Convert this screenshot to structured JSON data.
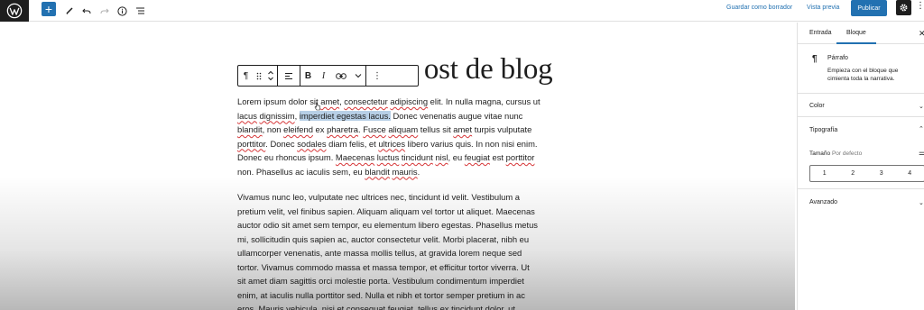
{
  "topbar": {
    "inserter_symbol": "+",
    "save_draft": "Guardar como borrador",
    "preview": "Vista previa",
    "publish": "Publicar",
    "icons": [
      "wordpress-logo",
      "plus-icon",
      "pen-icon",
      "undo-icon",
      "redo-icon",
      "info-icon",
      "list-view-icon",
      "gear-icon",
      "more-vertical-icon"
    ]
  },
  "editor": {
    "title_visible_end": "ost de blog",
    "toolbar": {
      "paragraph_symbol": "¶",
      "bold": "B",
      "italic": "I"
    },
    "paragraph1": {
      "lines": [
        [
          "Lorem ipsum dolor sit ",
          {
            "t": "amet",
            "sq": true
          },
          ", ",
          {
            "t": "consectetur",
            "sq": true
          },
          " ",
          {
            "t": "adipiscing",
            "sq": true
          },
          " elit. In nulla magna, cursus ut"
        ],
        [
          {
            "t": "lacus",
            "sq": true
          },
          " ",
          {
            "t": "dignissim",
            "sq": true
          },
          ", ",
          {
            "t": "imperdiet egestas lacus.",
            "hl": true
          },
          " Donec venenatis augue vitae nunc"
        ],
        [
          {
            "t": "blandit",
            "sq": true
          },
          ", non ",
          {
            "t": "eleifend",
            "sq": true
          },
          " ex ",
          {
            "t": "pharetra",
            "sq": true
          },
          ". ",
          {
            "t": "Fusce",
            "sq": true
          },
          " ",
          {
            "t": "aliquam",
            "sq": true
          },
          " tellus sit ",
          {
            "t": "amet",
            "sq": true
          },
          " turpis vulputate"
        ],
        [
          {
            "t": "porttitor",
            "sq": true
          },
          ". Donec ",
          {
            "t": "sodales",
            "sq": true
          },
          " diam felis, et ",
          {
            "t": "ultrices",
            "sq": true
          },
          " libero varius quis. In non nisi enim."
        ],
        [
          "Donec eu rhoncus ipsum. ",
          {
            "t": "Maecenas",
            "sq": true
          },
          " ",
          {
            "t": "luctus",
            "sq": true
          },
          " ",
          {
            "t": "tincidunt",
            "sq": true
          },
          " ",
          {
            "t": "nisl",
            "sq": true
          },
          ", eu ",
          {
            "t": "feugiat",
            "sq": true
          },
          " est ",
          {
            "t": "porttitor",
            "sq": true
          }
        ],
        [
          "non. Phasellus ac iaculis sem, eu ",
          {
            "t": "blandit",
            "sq": true
          },
          " ",
          {
            "t": "mauris",
            "sq": true
          },
          "."
        ]
      ]
    },
    "paragraph2": {
      "lines": [
        [
          "Vivamus nunc leo, vulputate nec ultrices nec, tincidunt id velit. Vestibulum a"
        ],
        [
          "pretium velit, vel finibus sapien. Aliquam aliquam vel tortor ut aliquet. Maecenas"
        ],
        [
          "auctor odio sit amet sem tempor, eu elementum libero egestas. Phasellus metus"
        ],
        [
          "mi, sollicitudin quis sapien ac, auctor consectetur velit. Morbi placerat, nibh eu"
        ],
        [
          "ullamcorper venenatis, ante massa mollis tellus, at gravida lorem neque sed"
        ],
        [
          "tortor. Vivamus commodo massa et massa tempor, et efficitur tortor viverra. Ut"
        ],
        [
          "sit amet diam sagittis orci molestie porta. Vestibulum condimentum imperdiet"
        ],
        [
          "enim, at iaculis nulla porttitor sed. Nulla et nibh et tortor semper pretium in ac"
        ],
        [
          "eros. Mauris vehicula, nisi et consequat feugiat, tellus ex tincidunt dolor, ut"
        ]
      ]
    }
  },
  "sidebar": {
    "tabs": [
      "Entrada",
      "Bloque"
    ],
    "active_tab": "Bloque",
    "block": {
      "icon": "¶",
      "name": "Párrafo",
      "description": "Empieza con el bloque que cimienta toda la narrativa."
    },
    "panels": {
      "color": "Color",
      "typography": "Tipografía",
      "advanced": "Avanzado"
    },
    "size": {
      "label": "Tamaño",
      "default": "Por defecto",
      "options": [
        "1",
        "2",
        "3",
        "4"
      ]
    }
  },
  "colors": {
    "accent": "#2271b1",
    "dark": "#1e1e1e",
    "highlight": "#b7cfe6",
    "spellcheck": "#d63638"
  }
}
